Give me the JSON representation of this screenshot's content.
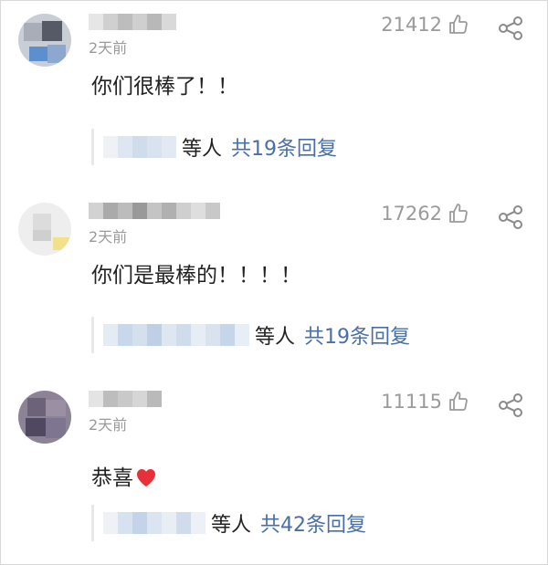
{
  "comments": [
    {
      "time": "2天前",
      "likes": "21412",
      "text": "你们很棒了！！",
      "reply_suffix": "等人",
      "reply_total": "共19条回复"
    },
    {
      "time": "2天前",
      "likes": "17262",
      "text": "你们是最棒的！！！！",
      "reply_suffix": "等人",
      "reply_total": "共19条回复"
    },
    {
      "time": "2天前",
      "likes": "11115",
      "text": "恭喜",
      "reply_suffix": "等人",
      "reply_total": "共42条回复"
    }
  ],
  "colors": {
    "meta_gray": "#9a9a9a",
    "link_blue": "#4a6fa5",
    "heart_red": "#e8303a"
  },
  "icons": [
    "thumbs-up-icon",
    "share-icon",
    "heart-emoji"
  ]
}
